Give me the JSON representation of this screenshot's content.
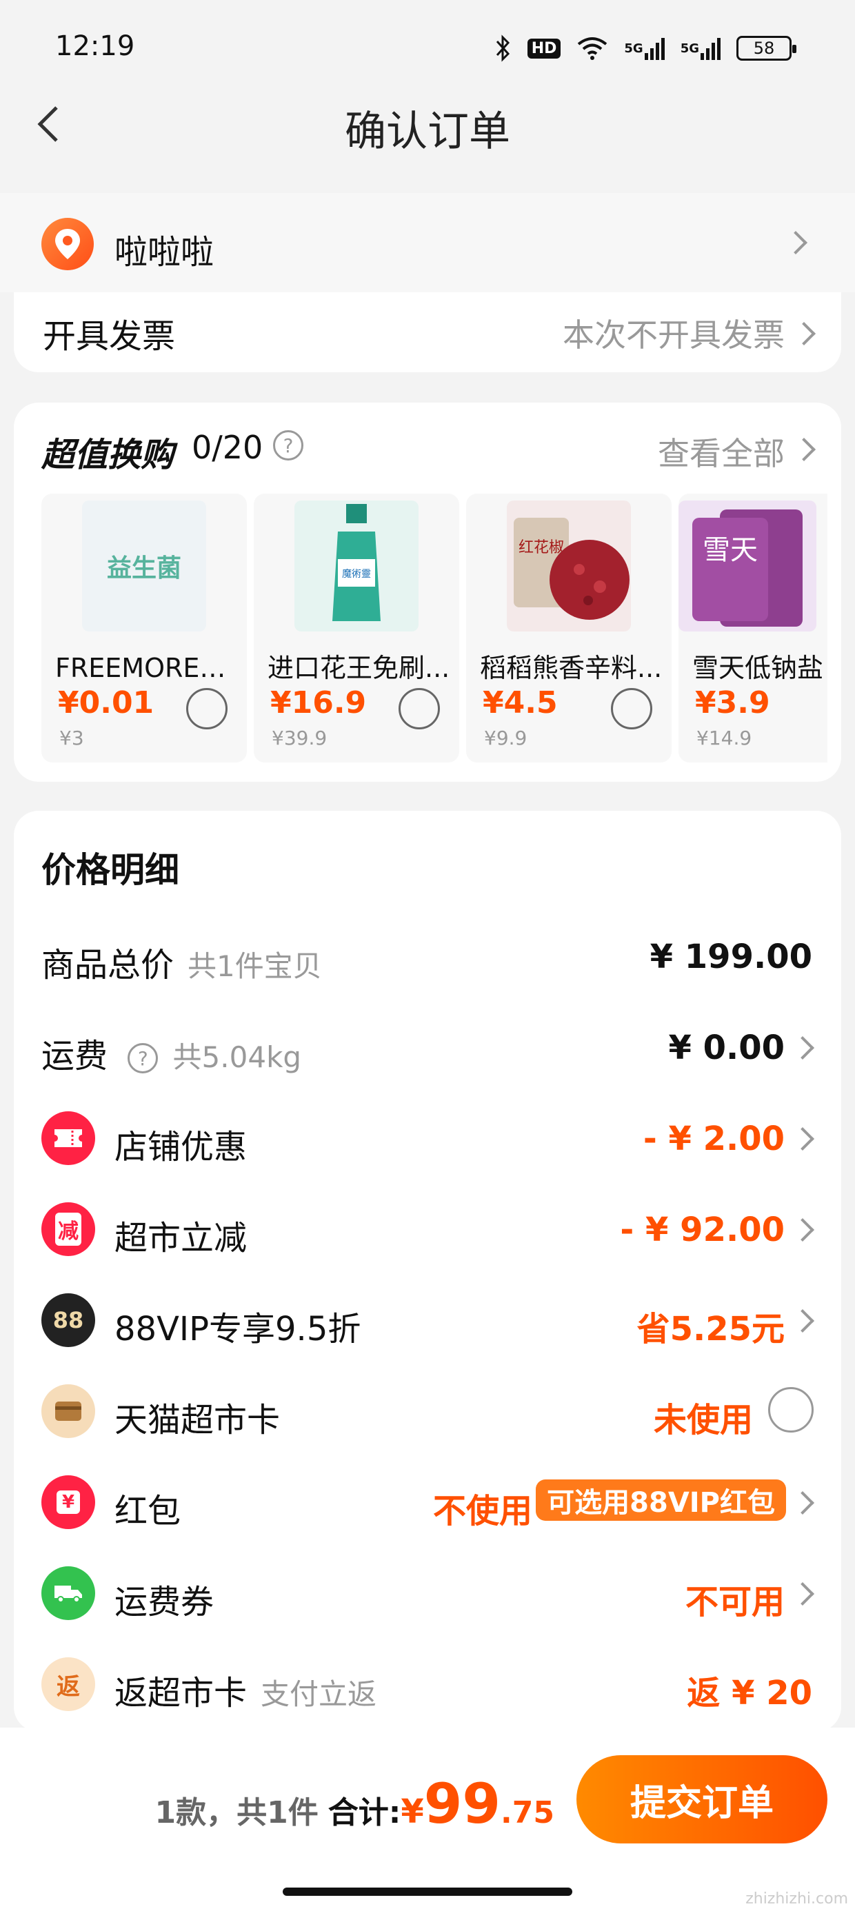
{
  "status_bar": {
    "time": "12:19",
    "battery": "58",
    "hd_badge": "HD",
    "net1": "5G",
    "net2": "5G"
  },
  "nav": {
    "title": "确认订单"
  },
  "address": {
    "name": "啦啦啦"
  },
  "invoice": {
    "label": "开具发票",
    "value": "本次不开具发票"
  },
  "bargain": {
    "title": "超值换购",
    "count": "0/20",
    "help": "?",
    "view_all": "查看全部",
    "products": [
      {
        "name": "FREEMORE自...",
        "price": "¥0.01",
        "orig": "¥3",
        "img_text": "益生菌",
        "img_color": "#eef3f6"
      },
      {
        "name": "进口花王免刷...",
        "price": "¥16.9",
        "orig": "¥39.9",
        "img_text": "魔術靈",
        "img_color": "#e6f4f1"
      },
      {
        "name": "稻稻熊香辛料...",
        "price": "¥4.5",
        "orig": "¥9.9",
        "img_text": "红花椒",
        "img_color": "#f4e9e9"
      },
      {
        "name": "雪天低钠盐",
        "price": "¥3.9",
        "orig": "¥14.9",
        "img_text": "雪天",
        "img_color": "#efe3f4"
      }
    ]
  },
  "price_detail": {
    "title": "价格明细",
    "rows": {
      "total": {
        "label": "商品总价",
        "sub": "共1件宝贝",
        "value": "¥ 199.00"
      },
      "shipping": {
        "label": "运费",
        "help": "?",
        "sub": "共5.04kg",
        "value": "¥ 0.00"
      },
      "store_discount": {
        "label": "店铺优惠",
        "value": "- ¥ 2.00",
        "icon": "coupon-icon"
      },
      "market_cut": {
        "label": "超市立减",
        "value": "- ¥ 92.00",
        "icon_text": "减"
      },
      "vip": {
        "label": "88VIP专享9.5折",
        "value": "省5.25元",
        "icon_text": "88"
      },
      "card": {
        "label": "天猫超市卡",
        "value": "未使用",
        "icon": "card-icon"
      },
      "hongbao": {
        "label": "红包",
        "value": "不使用",
        "badge": "可选用88VIP红包",
        "icon_text": "¥"
      },
      "freight_coupon": {
        "label": "运费券",
        "value": "不可用",
        "icon": "truck-icon"
      },
      "cashback": {
        "label": "返超市卡",
        "sub": "支付立返",
        "value": "返 ¥ 20",
        "icon_text": "返"
      }
    }
  },
  "bottom": {
    "count": "1款，共1件",
    "total_label": "合计:",
    "yen": "¥",
    "total_int": "99",
    "total_dec": ".75",
    "submit": "提交订单",
    "watermark": "zhizhizhi.com"
  },
  "colors": {
    "accent": "#ff5000",
    "gray_text": "#999999"
  }
}
